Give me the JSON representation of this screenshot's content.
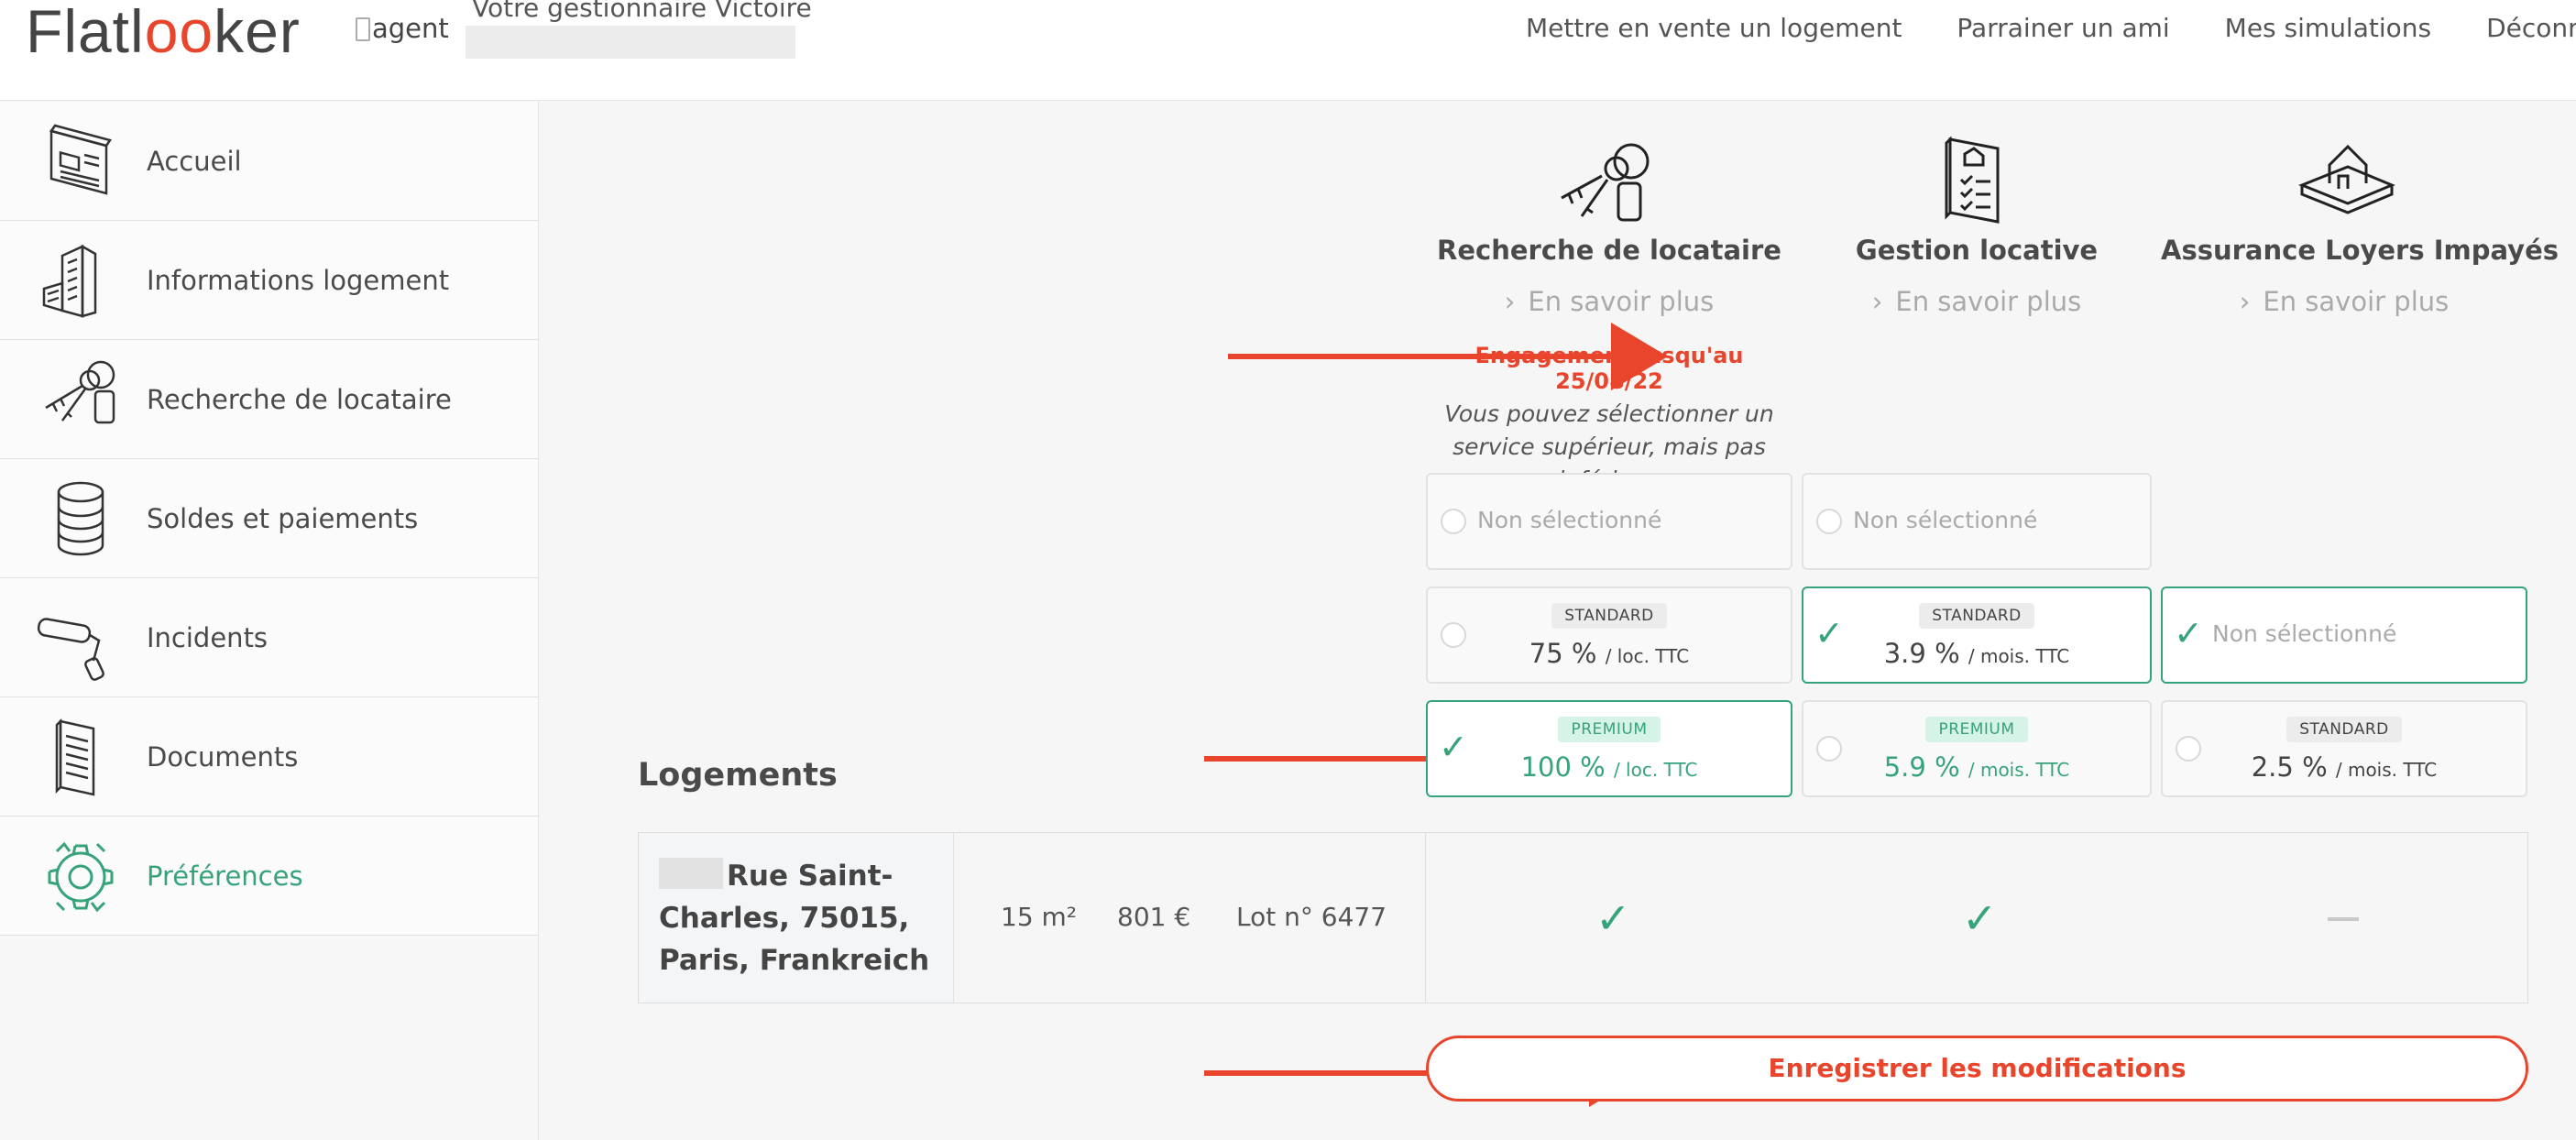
{
  "header": {
    "logo_pre": "Flatl",
    "logo_oo": "oo",
    "logo_post": "ker",
    "agent_alt": "agent",
    "manager": "Votre gestionnaire Victoire",
    "nav": [
      "Mettre en vente un logement",
      "Parrainer un ami",
      "Mes simulations",
      "Déconnexio"
    ]
  },
  "sidebar": {
    "items": [
      {
        "label": "Accueil",
        "icon": "dashboard-icon"
      },
      {
        "label": "Informations logement",
        "icon": "building-icon"
      },
      {
        "label": "Recherche de locataire",
        "icon": "keys-icon"
      },
      {
        "label": "Soldes et paiements",
        "icon": "coins-icon"
      },
      {
        "label": "Incidents",
        "icon": "paint-roller-icon"
      },
      {
        "label": "Documents",
        "icon": "document-icon"
      },
      {
        "label": "Préférences",
        "icon": "gear-icon"
      }
    ]
  },
  "services": [
    {
      "title": "Recherche de locataire",
      "more": "En savoir plus"
    },
    {
      "title": "Gestion locative",
      "more": "En savoir plus"
    },
    {
      "title": "Assurance Loyers Impayés",
      "more": "En savoir plus"
    }
  ],
  "engagement": {
    "title": "Engagement jusqu'au 25/08/22",
    "subtitle": "Vous pouvez sélectionner un service supérieur, mais pas inférieur."
  },
  "options": {
    "none_label": "Non sélectionné",
    "row2": [
      {
        "badge": "STANDARD",
        "value": "75 %",
        "unit": "/ loc. TTC"
      },
      {
        "badge": "STANDARD",
        "value": "3.9 %",
        "unit": "/ mois. TTC"
      },
      {
        "label": "Non sélectionné"
      }
    ],
    "row3": [
      {
        "badge": "PREMIUM",
        "value": "100 %",
        "unit": "/ loc. TTC"
      },
      {
        "badge": "PREMIUM",
        "value": "5.9 %",
        "unit": "/ mois. TTC"
      },
      {
        "badge": "STANDARD",
        "value": "2.5 %",
        "unit": "/ mois. TTC"
      }
    ]
  },
  "logements": {
    "heading": "Logements",
    "row": {
      "address": "Rue Saint-Charles, 75015, Paris, Frankreich",
      "surface": "15 m²",
      "rent": "801 €",
      "lot": "Lot n° 6477",
      "tick": "✓"
    }
  },
  "save_label": "Enregistrer les modifications",
  "colors": {
    "accent": "#e8452c",
    "green": "#37a37a"
  }
}
